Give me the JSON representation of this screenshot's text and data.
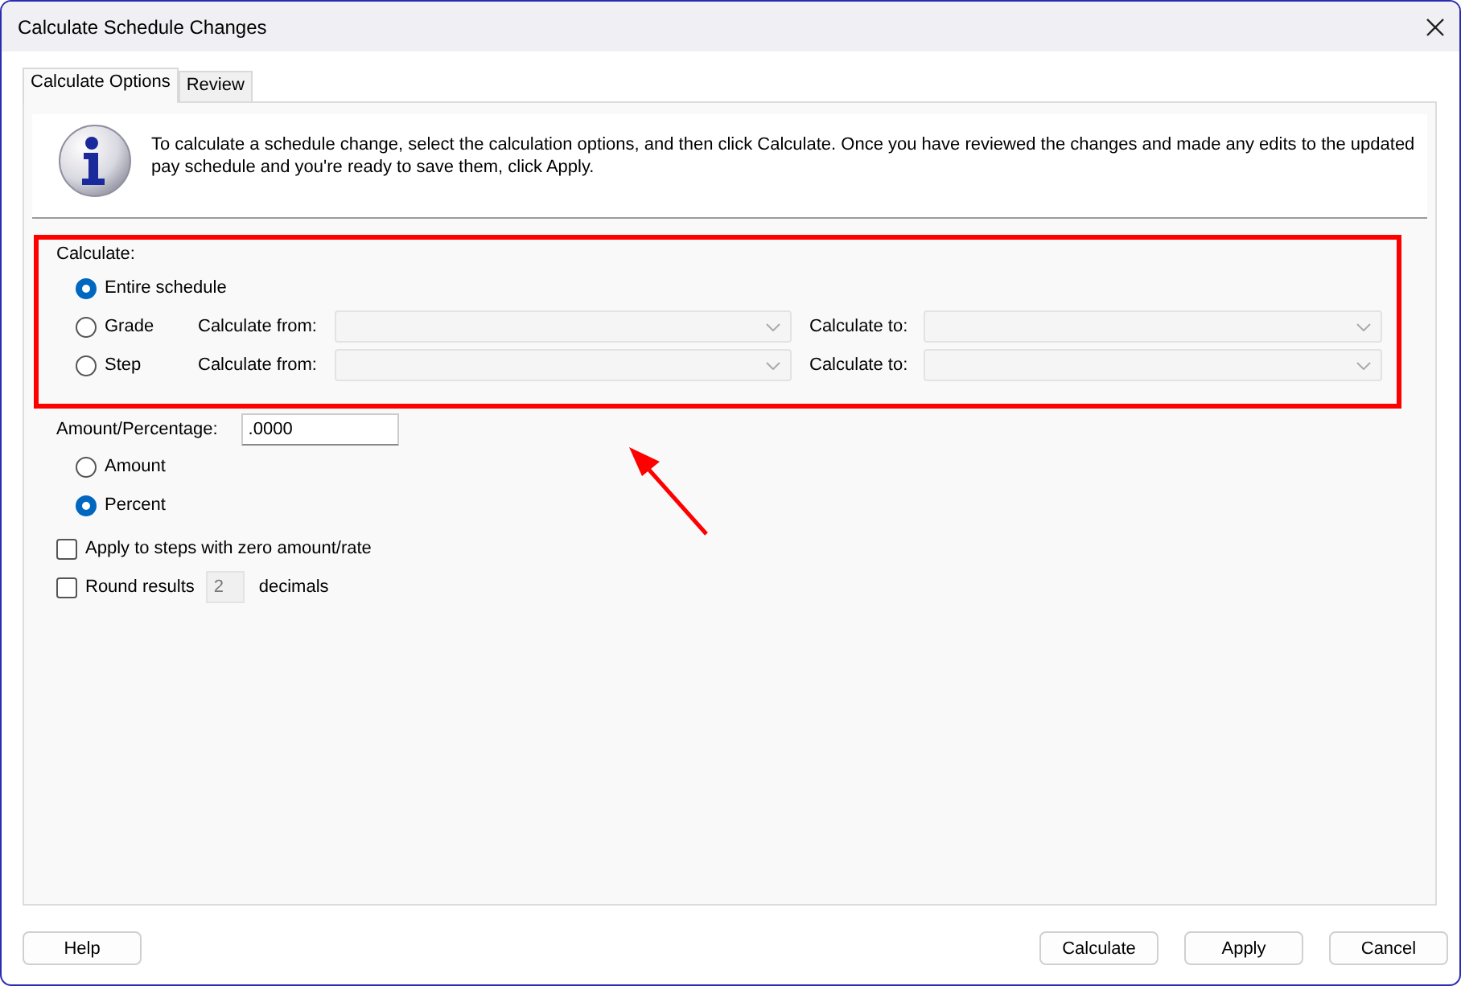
{
  "window": {
    "title": "Calculate Schedule Changes"
  },
  "tabs": [
    {
      "label": "Calculate Options",
      "selected": true
    },
    {
      "label": "Review",
      "selected": false
    }
  ],
  "info": {
    "text": "To calculate a schedule change, select the calculation options, and then click Calculate. Once you have reviewed the changes and made any edits to the updated pay schedule and you're ready to save them, click Apply."
  },
  "calculate": {
    "label": "Calculate:",
    "options": [
      {
        "label": "Entire schedule",
        "selected": true
      },
      {
        "label": "Grade",
        "selected": false,
        "from_label": "Calculate from:",
        "to_label": "Calculate to:"
      },
      {
        "label": "Step",
        "selected": false,
        "from_label": "Calculate from:",
        "to_label": "Calculate to:"
      }
    ]
  },
  "amount": {
    "label": "Amount/Percentage:",
    "value": ".0000",
    "options": [
      {
        "label": "Amount",
        "selected": false
      },
      {
        "label": "Percent",
        "selected": true
      }
    ]
  },
  "checks": [
    {
      "label": "Apply to steps with zero amount/rate",
      "checked": false
    },
    {
      "label": "Round results",
      "checked": false,
      "value": "2",
      "suffix": "decimals"
    }
  ],
  "buttons_left": [
    "Help"
  ],
  "buttons_right": [
    "Calculate",
    "Apply",
    "Cancel"
  ]
}
